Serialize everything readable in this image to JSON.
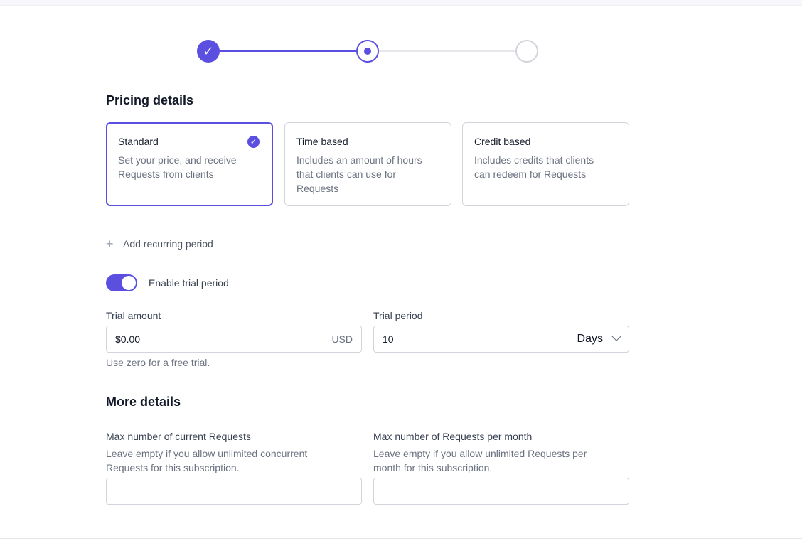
{
  "stepper": {
    "step1_icon": "check-icon",
    "step1_glyph": "✓",
    "accent": "#5b4fe0"
  },
  "pricing": {
    "title": "Pricing details",
    "options": [
      {
        "title": "Standard",
        "description": "Set your price, and receive Requests from clients",
        "selected": true
      },
      {
        "title": "Time based",
        "description": "Includes an amount of hours that clients can use for Requests",
        "selected": false
      },
      {
        "title": "Credit based",
        "description": "Includes credits that clients can redeem for Requests",
        "selected": false
      }
    ],
    "add_recurring_label": "Add recurring period",
    "check_glyph": "✓"
  },
  "trial": {
    "toggle_label": "Enable trial period",
    "enabled": true,
    "amount_label": "Trial amount",
    "amount_value": "$0.00",
    "amount_currency": "USD",
    "amount_help": "Use zero for a free trial.",
    "period_label": "Trial period",
    "period_value": "10",
    "period_unit": "Days"
  },
  "more": {
    "title": "More details",
    "max_current_label": "Max number of current Requests",
    "max_current_help": "Leave empty if you allow unlimited concurrent Requests for this subscription.",
    "max_current_value": "",
    "max_monthly_label": "Max number of Requests per month",
    "max_monthly_help": "Leave empty if you allow unlimited Requests per month for this subscription.",
    "max_monthly_value": ""
  }
}
